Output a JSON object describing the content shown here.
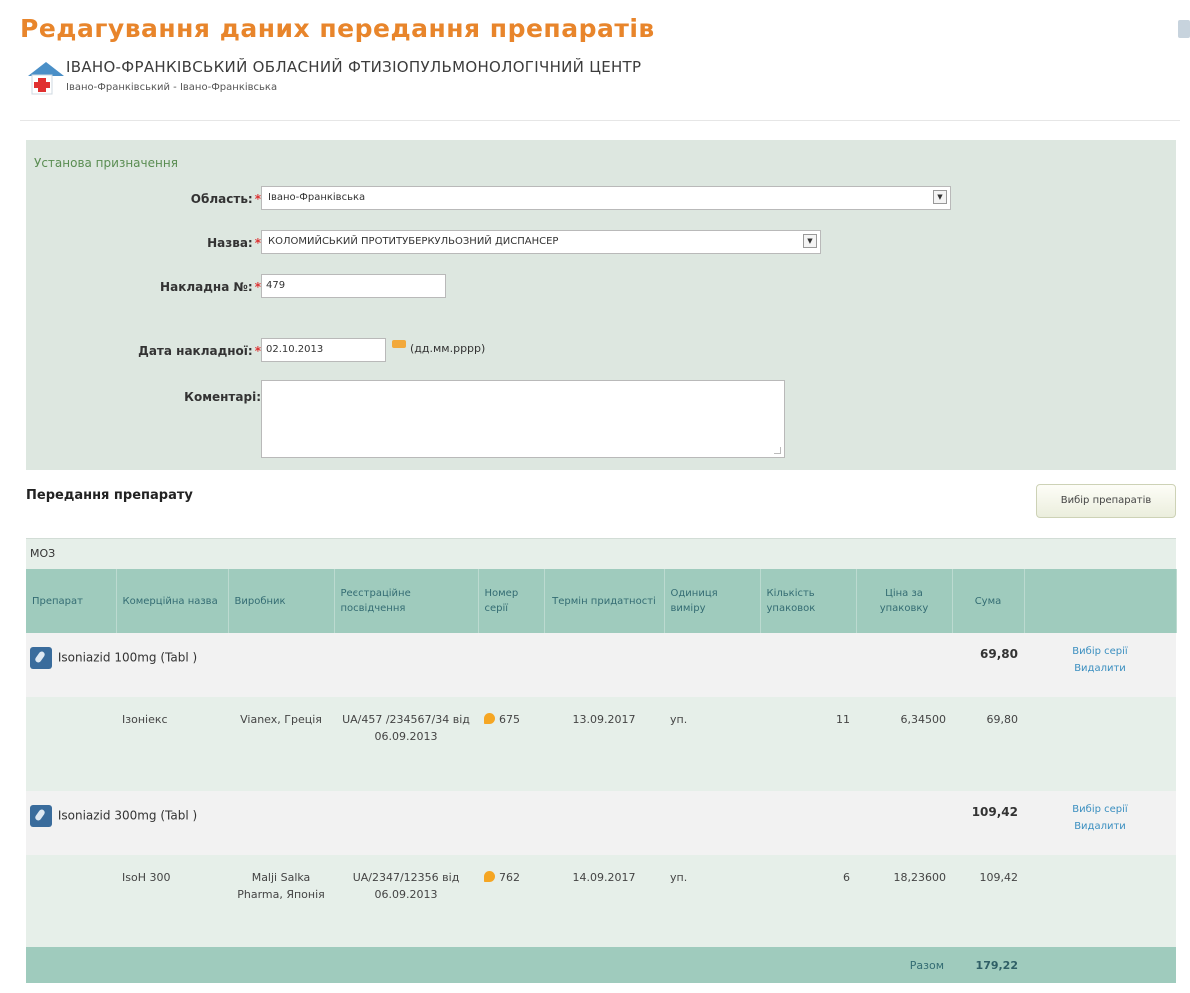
{
  "page": {
    "title": "Редагування даних передання препаратів",
    "org_name": "ІВАНО-ФРАНКІВСЬКИЙ ОБЛАСНИЙ ФТИЗІОПУЛЬМОНОЛОГІЧНИЙ ЦЕНТР",
    "org_location": "Івано-Франківський - Івано-Франківська"
  },
  "form": {
    "section_caption": "Установа призначення",
    "region": {
      "label": "Область:",
      "value": "Івано-Франківська"
    },
    "name": {
      "label": "Назва:",
      "value": "КОЛОМИЙСЬКИЙ ПРОТИТУБЕРКУЛЬОЗНИЙ ДИСПАНСЕР"
    },
    "invoice_no": {
      "label": "Накладна №:",
      "value": "479"
    },
    "invoice_date": {
      "label": "Дата накладної:",
      "value": "02.10.2013",
      "hint": "(дд.мм.рррр)"
    },
    "comments": {
      "label": "Коментарі:",
      "value": ""
    },
    "required_mark": "*"
  },
  "transfer": {
    "section_title": "Передання препарату",
    "select_drugs_button": "Вибір препаратів",
    "group_label": "МОЗ",
    "columns": [
      "Препарат",
      "Комерційна назва",
      "Виробник",
      "Реєстраційне посвідчення",
      "Номер серії",
      "Термін придатності",
      "Одиниця виміру",
      "Кількість упаковок",
      "Ціна за упаковку",
      "Сума",
      ""
    ],
    "drugs": [
      {
        "name": "Isoniazid 100mg (Tabl )",
        "sum": "69,80",
        "actions": [
          "Вибір серії",
          "Видалити"
        ],
        "detail": {
          "commercial_name": "Ізоніекс",
          "manufacturer": "Vianex, Греція",
          "registration": "UA/457 /234567/34 від 06.09.2013",
          "serial": "675",
          "expiry": "13.09.2017",
          "unit": "уп.",
          "quantity": "11",
          "price": "6,34500",
          "sum": "69,80"
        }
      },
      {
        "name": "Isoniazid 300mg (Tabl )",
        "sum": "109,42",
        "actions": [
          "Вибір серії",
          "Видалити"
        ],
        "detail": {
          "commercial_name": "IsoH 300",
          "manufacturer": "Malji Salka Pharma, Японія",
          "registration": "UA/2347/12356 від 06.09.2013",
          "serial": "762",
          "expiry": "14.09.2017",
          "unit": "уп.",
          "quantity": "6",
          "price": "18,23600",
          "sum": "109,42"
        }
      }
    ],
    "total_label": "Разом",
    "total": "179,22"
  }
}
